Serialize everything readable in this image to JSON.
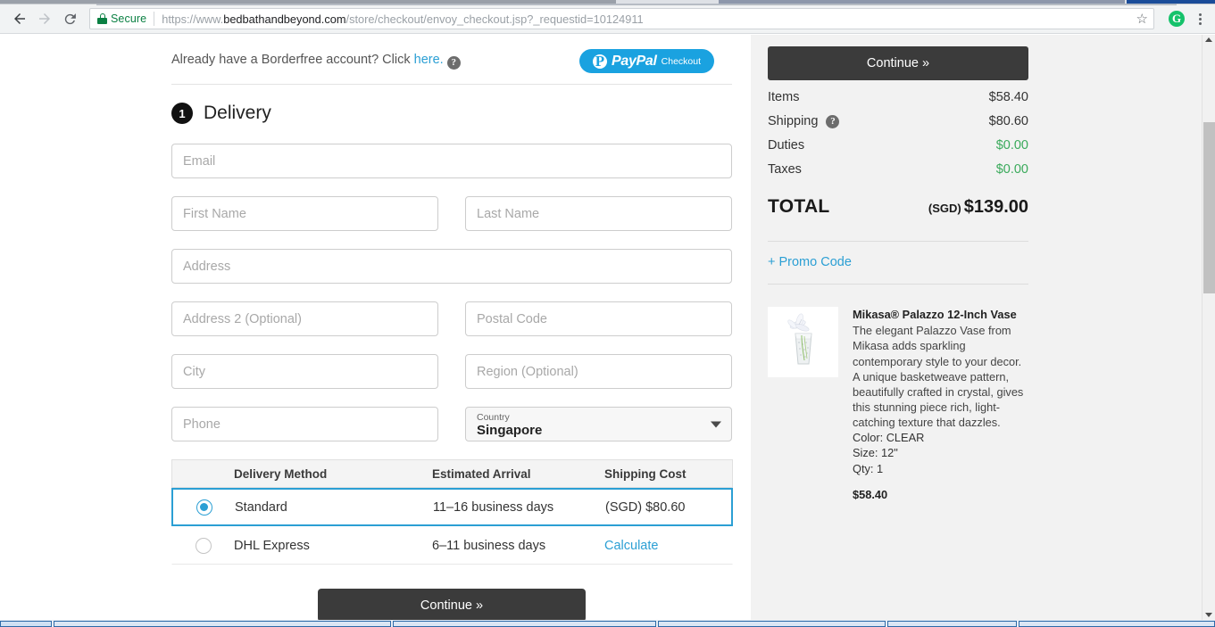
{
  "browser": {
    "security_label": "Secure",
    "url_full": "https://www.bedbathandbeyond.com/store/checkout/envoy_checkout.jsp?_requestid=10124911",
    "url_prefix": "https://www.",
    "url_host": "bedbathandbeyond.com",
    "url_path": "/store/checkout/envoy_checkout.jsp?_requestid=10124911",
    "back_icon": "back-arrow-icon",
    "forward_icon": "forward-arrow-icon",
    "reload_icon": "reload-icon",
    "bookmark_icon": "star-icon",
    "extension_icon": "grammarly-icon",
    "extension_letter": "G",
    "menu_icon": "kebab-menu-icon"
  },
  "header": {
    "borderfree_text": "Already have a Borderfree account? Click ",
    "borderfree_link": "here.",
    "help_icon_label": "?",
    "paypal": {
      "mark": "P",
      "word": "PayPal",
      "sub": "Checkout"
    }
  },
  "step": {
    "number": "1",
    "title": "Delivery"
  },
  "form": {
    "email": {
      "placeholder": "Email",
      "value": ""
    },
    "first_name": {
      "placeholder": "First Name",
      "value": ""
    },
    "last_name": {
      "placeholder": "Last Name",
      "value": ""
    },
    "address": {
      "placeholder": "Address",
      "value": ""
    },
    "address2": {
      "placeholder": "Address 2 (Optional)",
      "value": ""
    },
    "postal_code": {
      "placeholder": "Postal Code",
      "value": ""
    },
    "city": {
      "placeholder": "City",
      "value": ""
    },
    "region": {
      "placeholder": "Region (Optional)",
      "value": ""
    },
    "phone": {
      "placeholder": "Phone",
      "value": ""
    },
    "country": {
      "label": "Country",
      "value": "Singapore"
    }
  },
  "delivery_table": {
    "headers": {
      "method": "Delivery Method",
      "arrival": "Estimated Arrival",
      "cost": "Shipping Cost"
    },
    "rows": [
      {
        "method": "Standard",
        "arrival": "11–16 business days",
        "cost": "(SGD) $80.60",
        "selected": true,
        "cost_is_link": false
      },
      {
        "method": "DHL Express",
        "arrival": "6–11 business days",
        "cost": "Calculate",
        "selected": false,
        "cost_is_link": true
      }
    ]
  },
  "main_continue_label": "Continue »",
  "summary": {
    "continue_label": "Continue »",
    "lines": [
      {
        "label": "Items",
        "value": "$58.40",
        "green": false,
        "has_help": false
      },
      {
        "label": "Shipping",
        "value": "$80.60",
        "green": false,
        "has_help": true
      },
      {
        "label": "Duties",
        "value": "$0.00",
        "green": true,
        "has_help": false
      },
      {
        "label": "Taxes",
        "value": "$0.00",
        "green": true,
        "has_help": false
      }
    ],
    "total_label": "TOTAL",
    "total_currency": "(SGD)",
    "total_value": "$139.00",
    "promo_label": "+ Promo Code"
  },
  "product": {
    "name": "Mikasa® Palazzo 12-Inch Vase",
    "description": "The elegant Palazzo Vase from Mikasa adds sparkling contemporary style to your decor. A unique basketweave pattern, beautifully crafted in crystal, gives this stunning piece rich, light-catching texture that dazzles.",
    "color": "Color: CLEAR",
    "size": "Size: 12\"",
    "qty": "Qty: 1",
    "price": "$58.40",
    "image_alt": "crystal-vase-thumbnail"
  },
  "colors": {
    "accent_blue": "#2b9fd4",
    "green": "#3aaa5b",
    "dark_button": "#3b3b3b",
    "sidebar_bg": "#f2f2f2",
    "paypal_blue": "#1aa2e0"
  }
}
